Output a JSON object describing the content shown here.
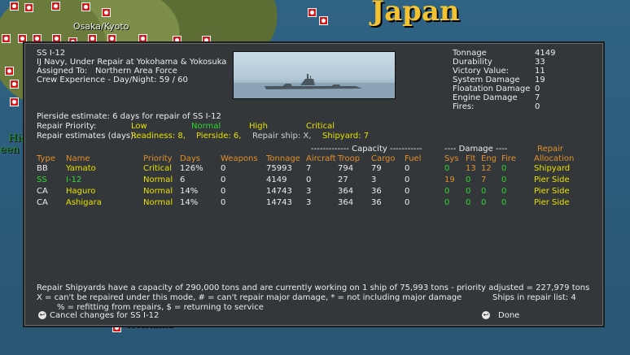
{
  "map": {
    "region_title": "Japan",
    "city_label": "Osaka/Kyoto",
    "left_text_1": "Hig",
    "left_text_2": "een",
    "bottom_text": "Iorishima"
  },
  "dialog": {
    "ship_name": "SS I-12",
    "status_line": "IJ Navy, Under Repair at Yokohama & Yokosuka",
    "assigned_label": "Assigned To:",
    "assigned_value": "Northern Area Force",
    "crew_label": "Crew Experience - Day/Night:",
    "crew_day": "59",
    "crew_sep": "/",
    "crew_night": "60",
    "stats": [
      {
        "label": "Tonnage",
        "value": "4149"
      },
      {
        "label": "Durability",
        "value": "33"
      },
      {
        "label": "Victory Value:",
        "value": "11"
      },
      {
        "label": "System Damage",
        "value": "19"
      },
      {
        "label": "Floatation Damage",
        "value": "0"
      },
      {
        "label": "Engine Damage",
        "value": "7"
      },
      {
        "label": "Fires:",
        "value": "0"
      }
    ],
    "pierside_estimate": "Pierside estimate: 6 days for repair of SS I-12",
    "priority_label": "Repair Priority:",
    "priority_low": "Low",
    "priority_normal": "Normal",
    "priority_high": "High",
    "priority_critical": "Critical",
    "estimates_label": "Repair estimates (days):",
    "est_readiness": "Readiness: 8,",
    "est_pierside": "Pierside: 6,",
    "est_repair_ship": "Repair ship: X,",
    "est_shipyard": "Shipyard: 7",
    "group_capacity": "------------- Capacity -----------",
    "group_damage": "---- Damage ----",
    "group_repair": "Repair",
    "headers": {
      "type": "Type",
      "name": "Name",
      "priority": "Priority",
      "days": "Days",
      "weapons": "Weapons",
      "tonnage": "Tonnage",
      "aircraft": "Aircraft",
      "troop": "Troop",
      "cargo": "Cargo",
      "fuel": "Fuel",
      "sys": "Sys",
      "flt": "Flt",
      "eng": "Eng",
      "fire": "Fire",
      "allocation": "Allocation"
    },
    "rows": [
      {
        "type": "BB",
        "name": "Yamato",
        "priority": "Critical",
        "days": "126%",
        "weapons": "0",
        "tonnage": "75993",
        "aircraft": "7",
        "troop": "794",
        "cargo": "79",
        "fuel": "0",
        "sys": "0",
        "flt": "13",
        "eng": "12",
        "fire": "0",
        "allocation": "Shipyard"
      },
      {
        "type": "SS",
        "name": "I-12",
        "priority": "Normal",
        "days": "6",
        "weapons": "0",
        "tonnage": "4149",
        "aircraft": "0",
        "troop": "27",
        "cargo": "3",
        "fuel": "0",
        "sys": "19",
        "flt": "0",
        "eng": "7",
        "fire": "0",
        "allocation": "Pier Side"
      },
      {
        "type": "CA",
        "name": "Haguro",
        "priority": "Normal",
        "days": "14%",
        "weapons": "0",
        "tonnage": "14743",
        "aircraft": "3",
        "troop": "364",
        "cargo": "36",
        "fuel": "0",
        "sys": "0",
        "flt": "0",
        "eng": "0",
        "fire": "0",
        "allocation": "Pier Side"
      },
      {
        "type": "CA",
        "name": "Ashigara",
        "priority": "Normal",
        "days": "14%",
        "weapons": "0",
        "tonnage": "14743",
        "aircraft": "3",
        "troop": "364",
        "cargo": "36",
        "fuel": "0",
        "sys": "0",
        "flt": "0",
        "eng": "0",
        "fire": "0",
        "allocation": "Pier Side"
      }
    ],
    "capacity_note": "Repair Shipyards have a capacity of 290,000 tons and are currently working on 1 ship of 75,993 tons - priority adjusted = 227,979 tons",
    "legend_line1": "X = can't be repaired under this mode, # = can't repair major damage, * = not including major damage",
    "ships_in_list": "Ships in repair list: 4",
    "legend_line2": "% = refitting from repairs, $ = returning to service",
    "cancel_label": "Cancel changes for SS I-12",
    "done_label": "Done"
  }
}
